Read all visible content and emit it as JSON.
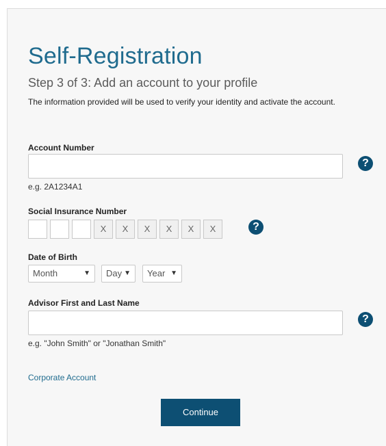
{
  "header": {
    "title": "Self-Registration",
    "step": "Step 3 of 3: Add an account to your profile",
    "intro": "The information provided will be used to verify your identity and activate the account."
  },
  "account_number": {
    "label": "Account Number",
    "value": "",
    "hint": "e.g. 2A1234A1"
  },
  "sin": {
    "label": "Social Insurance Number",
    "boxes": [
      "",
      "",
      "",
      "X",
      "X",
      "X",
      "X",
      "X",
      "X"
    ]
  },
  "dob": {
    "label": "Date of Birth",
    "month": "Month",
    "day": "Day",
    "year": "Year"
  },
  "advisor": {
    "label": "Advisor First and Last Name",
    "value": "",
    "hint": "e.g. \"John Smith\" or \"Jonathan Smith\""
  },
  "links": {
    "corporate_account": "Corporate Account"
  },
  "buttons": {
    "continue": "Continue"
  },
  "icons": {
    "help": "?"
  },
  "colors": {
    "title": "#1f6b8e",
    "primary": "#0d4f73",
    "panel_bg": "#f7f7f7"
  }
}
